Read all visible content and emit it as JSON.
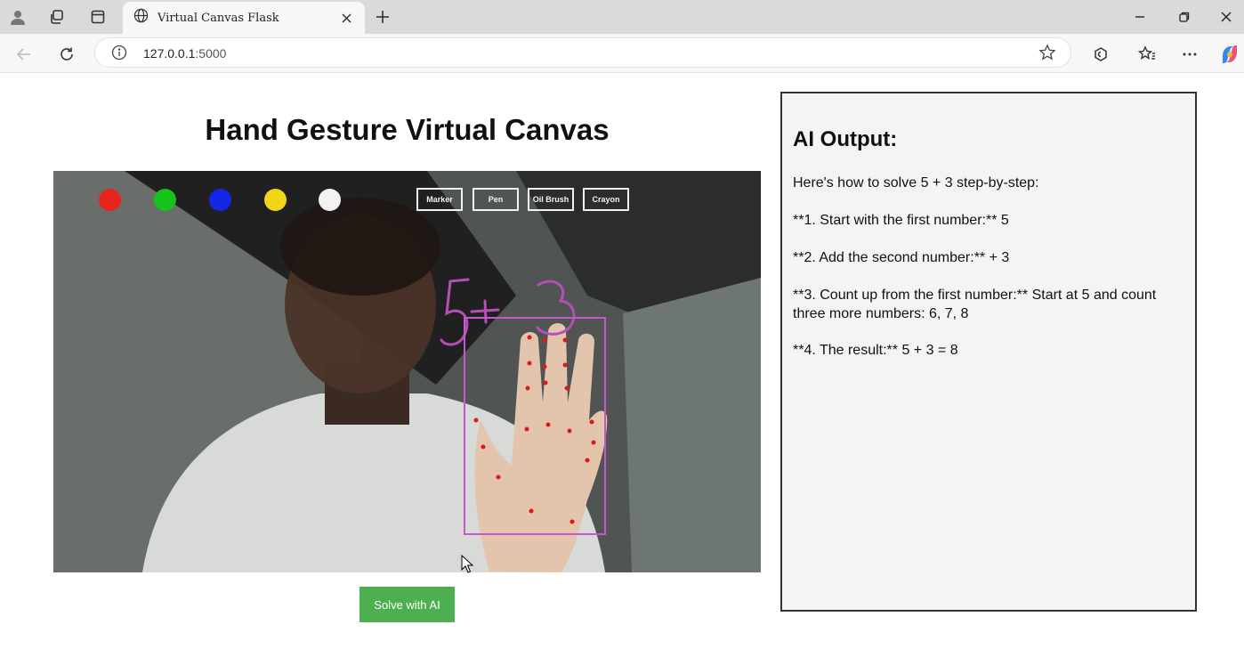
{
  "browser": {
    "tab_title": "Virtual Canvas Flask",
    "url_host": "127.0.0.1",
    "url_port": ":5000"
  },
  "page": {
    "title": "Hand Gesture Virtual Canvas",
    "solve_button": "Solve with AI"
  },
  "canvas": {
    "colors": [
      "#e8251c",
      "#17c21c",
      "#1526e6",
      "#f2d51b",
      "#f2f2f2"
    ],
    "brushes": [
      "Marker",
      "Pen",
      "Oil Brush",
      "Crayon"
    ],
    "drawn_text": "5+3",
    "stroke_color": "#b44fb8"
  },
  "ai_output": {
    "heading": "AI Output:",
    "intro": "Here's how to solve 5 + 3 step-by-step:",
    "step1": "**1. Start with the first number:** 5",
    "step2": "**2. Add the second number:** + 3",
    "step3": "**3. Count up from the first number:** Start at 5 and count three more numbers: 6, 7, 8",
    "step4": "**4. The result:** 5 + 3 = 8"
  }
}
